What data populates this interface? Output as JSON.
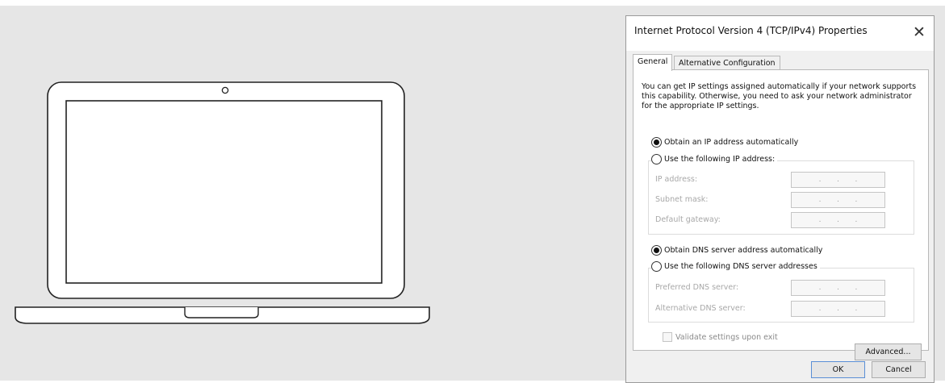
{
  "dialog": {
    "title": "Internet Protocol Version 4 (TCP/IPv4) Properties",
    "close_glyph": "✕",
    "tabs": [
      {
        "label": "General",
        "active": true
      },
      {
        "label": "Alternative Configuration",
        "active": false
      }
    ],
    "intro_text": "You can get IP settings assigned automatically if your network supports this capability. Otherwise, you need to ask your network administrator for the appropriate IP settings.",
    "ip_section": {
      "auto_label": "Obtain an IP address automatically",
      "auto_selected": true,
      "manual_label": "Use the following IP address:",
      "manual_selected": false,
      "fields": [
        {
          "label": "IP address:",
          "value": ". . ."
        },
        {
          "label": "Subnet mask:",
          "value": ". . ."
        },
        {
          "label": "Default gateway:",
          "value": ". . ."
        }
      ]
    },
    "dns_section": {
      "auto_label": "Obtain DNS server address automatically",
      "auto_selected": true,
      "manual_label": "Use the following DNS server addresses",
      "manual_selected": false,
      "fields": [
        {
          "label": "Preferred DNS server:",
          "value": ". . ."
        },
        {
          "label": "Alternative DNS server:",
          "value": ". . ."
        }
      ]
    },
    "validate_label": "Validate settings upon exit",
    "validate_checked": false,
    "advanced_label": "Advanced...",
    "ok_label": "OK",
    "cancel_label": "Cancel"
  },
  "colors": {
    "background": "#e6e6e6",
    "dialog_body": "#f0f0f0",
    "disabled_text": "#a8a8a8",
    "ok_border": "#5a8fd6"
  },
  "icons": {
    "laptop": "laptop-icon",
    "close": "close-icon"
  }
}
